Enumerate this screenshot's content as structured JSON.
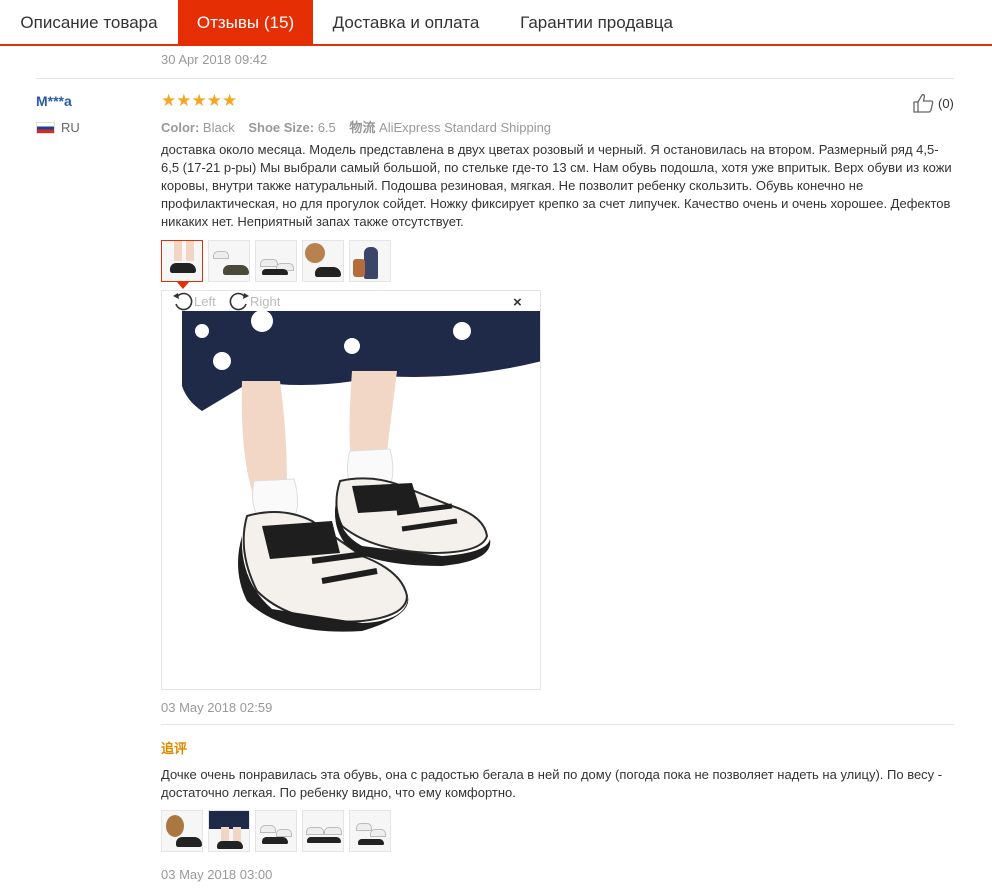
{
  "tabs": [
    {
      "label": "Описание товара",
      "active": false
    },
    {
      "label": "Отзывы (15)",
      "active": true
    },
    {
      "label": "Доставка и оплата",
      "active": false
    },
    {
      "label": "Гарантии продавца",
      "active": false
    }
  ],
  "previous_review_date": "30 Apr 2018 09:42",
  "review": {
    "buyer_name": "M***a",
    "country_code": "RU",
    "rating": 5,
    "likes": "(0)",
    "attrs": {
      "color_key": "Color:",
      "color_val": "Black",
      "size_key": "Shoe Size:",
      "size_val": "6.5",
      "ship_key": "物流",
      "ship_val": "AliExpress Standard Shipping"
    },
    "text": "доставка около месяца. Модель представлена в двух цветах розовый и черный. Я остановилась на втором. Размерный ряд 4,5-6,5 (17-21 р-ры) Мы выбрали самый большой, по стельке где-то 13 см. Нам обувь подошла, хотя уже впритык. Верх обуви из кожи коровы, внутри также натуральный. Подошва резиновая, мягкая. Не позволит ребенку скользить. Обувь конечно не профилактическая, но для прогулок сойдет. Ножку фиксирует крепко за счет липучек. Качество очень и очень хорошее. Дефектов никаких нет. Неприятный запах также отсутствует.",
    "viewer": {
      "rotate_left": "Left",
      "rotate_right": "Right",
      "close": "×"
    },
    "date": "03 May 2018 02:59"
  },
  "followup": {
    "title": "追评",
    "text": "Дочке очень понравилась эта обувь, она с радостью бегала в ней по дому (погода пока не позволяет надеть на улицу). По весу - достаточно легкая. По ребенку видно, что ему комфортно.",
    "date": "03 May 2018 03:00"
  },
  "colors": {
    "accent": "#e62e04",
    "star": "#f5a623",
    "buyer_link": "#2c5aa0",
    "followup_title": "#e08a00"
  }
}
